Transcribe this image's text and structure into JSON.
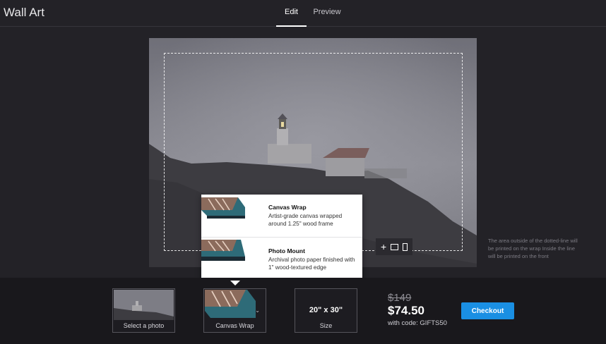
{
  "app": {
    "title": "Wall Art"
  },
  "tabs": [
    {
      "label": "Edit",
      "active": true
    },
    {
      "label": "Preview",
      "active": false
    }
  ],
  "editor": {
    "note": "The area outside of the dotted-line will be printed on the wrap Inside the line will be printed on the front",
    "zoom_icons": [
      "plus-icon",
      "square-crop-icon",
      "portrait-crop-icon"
    ]
  },
  "popover": {
    "items": [
      {
        "name": "Canvas Wrap",
        "desc": "Artist-grade canvas wrapped around 1.25\" wood frame"
      },
      {
        "name": "Photo Mount",
        "desc": "Archival photo paper finished with 1\" wood-textured edge"
      }
    ]
  },
  "options": {
    "photo_label": "Select a photo",
    "product_label": "Canvas Wrap",
    "size_value": "20\" x 30\"",
    "size_label": "Size"
  },
  "pricing": {
    "old": "$149",
    "new": "$74.50",
    "promo": "with code: GIFTS50"
  },
  "checkout": {
    "label": "Checkout"
  },
  "colors": {
    "accent": "#1a8fe3",
    "background": "#232227",
    "bar": "#19181c"
  }
}
